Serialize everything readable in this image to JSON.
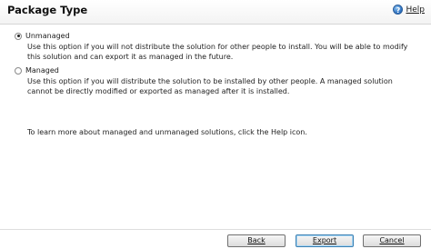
{
  "header": {
    "title": "Package Type",
    "help_label": "Help",
    "help_icon": "help-icon"
  },
  "options": [
    {
      "label": "Unmanaged",
      "checked": true,
      "description": "Use this option if you will not distribute the solution for other people to install. You will be able to modify this solution and can export it as managed in the future."
    },
    {
      "label": "Managed",
      "checked": false,
      "description": "Use this option if you will distribute the solution to be installed by other people. A managed solution cannot be directly modified or exported as managed after it is installed."
    }
  ],
  "help_note": "To learn more about managed and unmanaged solutions, click the Help icon.",
  "buttons": {
    "back": "Back",
    "export": "Export",
    "cancel": "Cancel"
  }
}
